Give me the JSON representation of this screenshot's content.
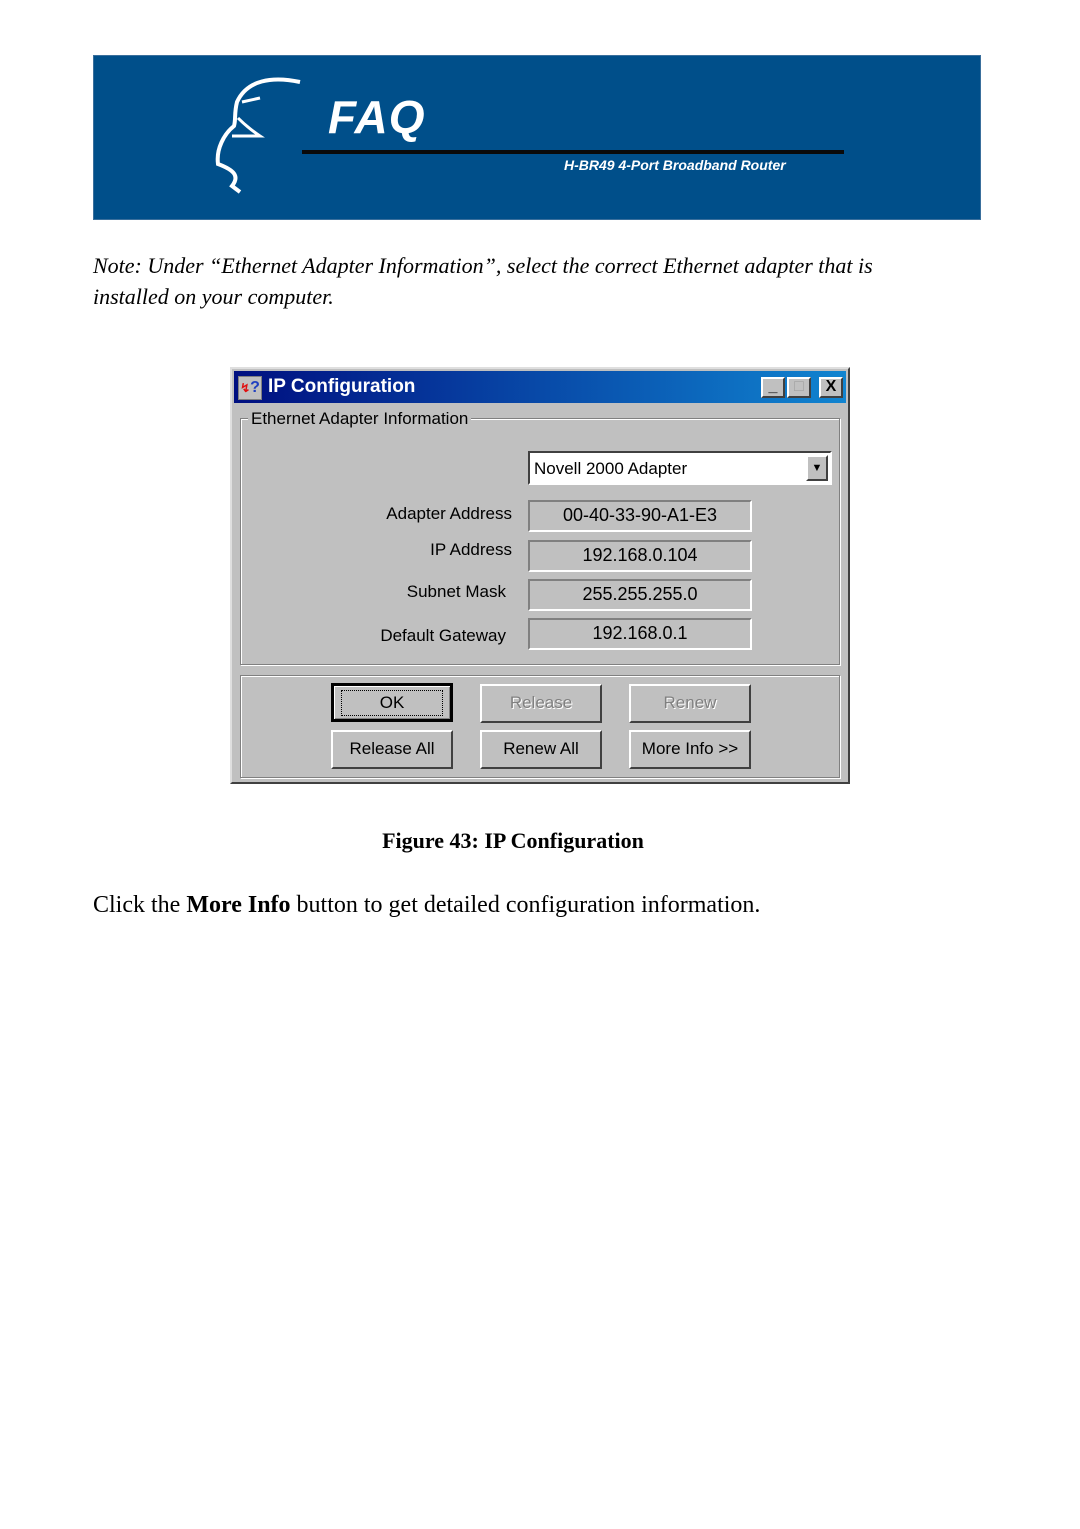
{
  "banner": {
    "title": "FAQ",
    "product": "H-BR49 4-Port Broadband Router",
    "background_color": "#004f8a"
  },
  "note": "Note: Under “Ethernet Adapter Information”, select the correct Ethernet adapter that is installed on your computer.",
  "window": {
    "title": "IP Configuration",
    "app_icon": "ipconfig-icon",
    "controls": {
      "minimize": "_",
      "maximize": "□",
      "close": "X"
    },
    "group_label": "Ethernet  Adapter Information",
    "adapter_select": {
      "value": "Novell 2000 Adapter"
    },
    "fields": [
      {
        "label": "Adapter Address",
        "value": "00-40-33-90-A1-E3"
      },
      {
        "label": "IP Address",
        "value": "192.168.0.104"
      },
      {
        "label": "Subnet Mask",
        "value": "255.255.255.0"
      },
      {
        "label": "Default Gateway",
        "value": "192.168.0.1"
      }
    ],
    "buttons": {
      "ok": "OK",
      "release": "Release",
      "renew": "Renew",
      "release_all": "Release All",
      "renew_all": "Renew All",
      "more_info": "More Info >>"
    }
  },
  "caption": "Figure 43: IP Configuration",
  "body": {
    "prefix": "Click the ",
    "bold": "More Info",
    "suffix": " button to get detailed configuration information."
  }
}
